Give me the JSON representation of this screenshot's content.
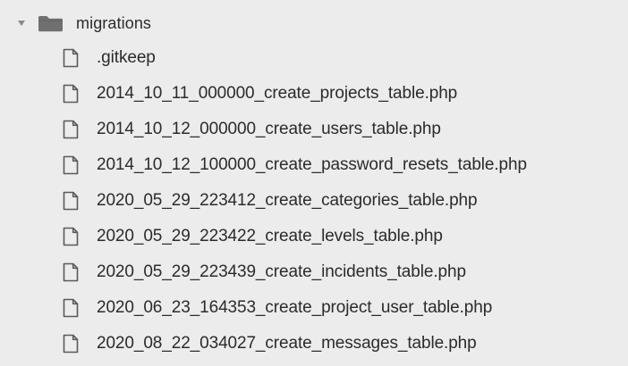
{
  "folder": {
    "name": "migrations",
    "expanded": true,
    "twisty_icon": "triangle-down-icon",
    "folder_icon": "folder-icon",
    "file_icon": "file-icon",
    "files": [
      {
        "name": ".gitkeep"
      },
      {
        "name": "2014_10_11_000000_create_projects_table.php"
      },
      {
        "name": "2014_10_12_000000_create_users_table.php"
      },
      {
        "name": "2014_10_12_100000_create_password_resets_table.php"
      },
      {
        "name": "2020_05_29_223412_create_categories_table.php"
      },
      {
        "name": "2020_05_29_223422_create_levels_table.php"
      },
      {
        "name": "2020_05_29_223439_create_incidents_table.php"
      },
      {
        "name": "2020_06_23_164353_create_project_user_table.php"
      },
      {
        "name": "2020_08_22_034027_create_messages_table.php"
      }
    ]
  },
  "colors": {
    "background": "#ececec",
    "text": "#2b2b2b",
    "folder_fill": "#707070",
    "twisty": "#8a8a8a",
    "file_stroke": "#5a5a5a"
  }
}
